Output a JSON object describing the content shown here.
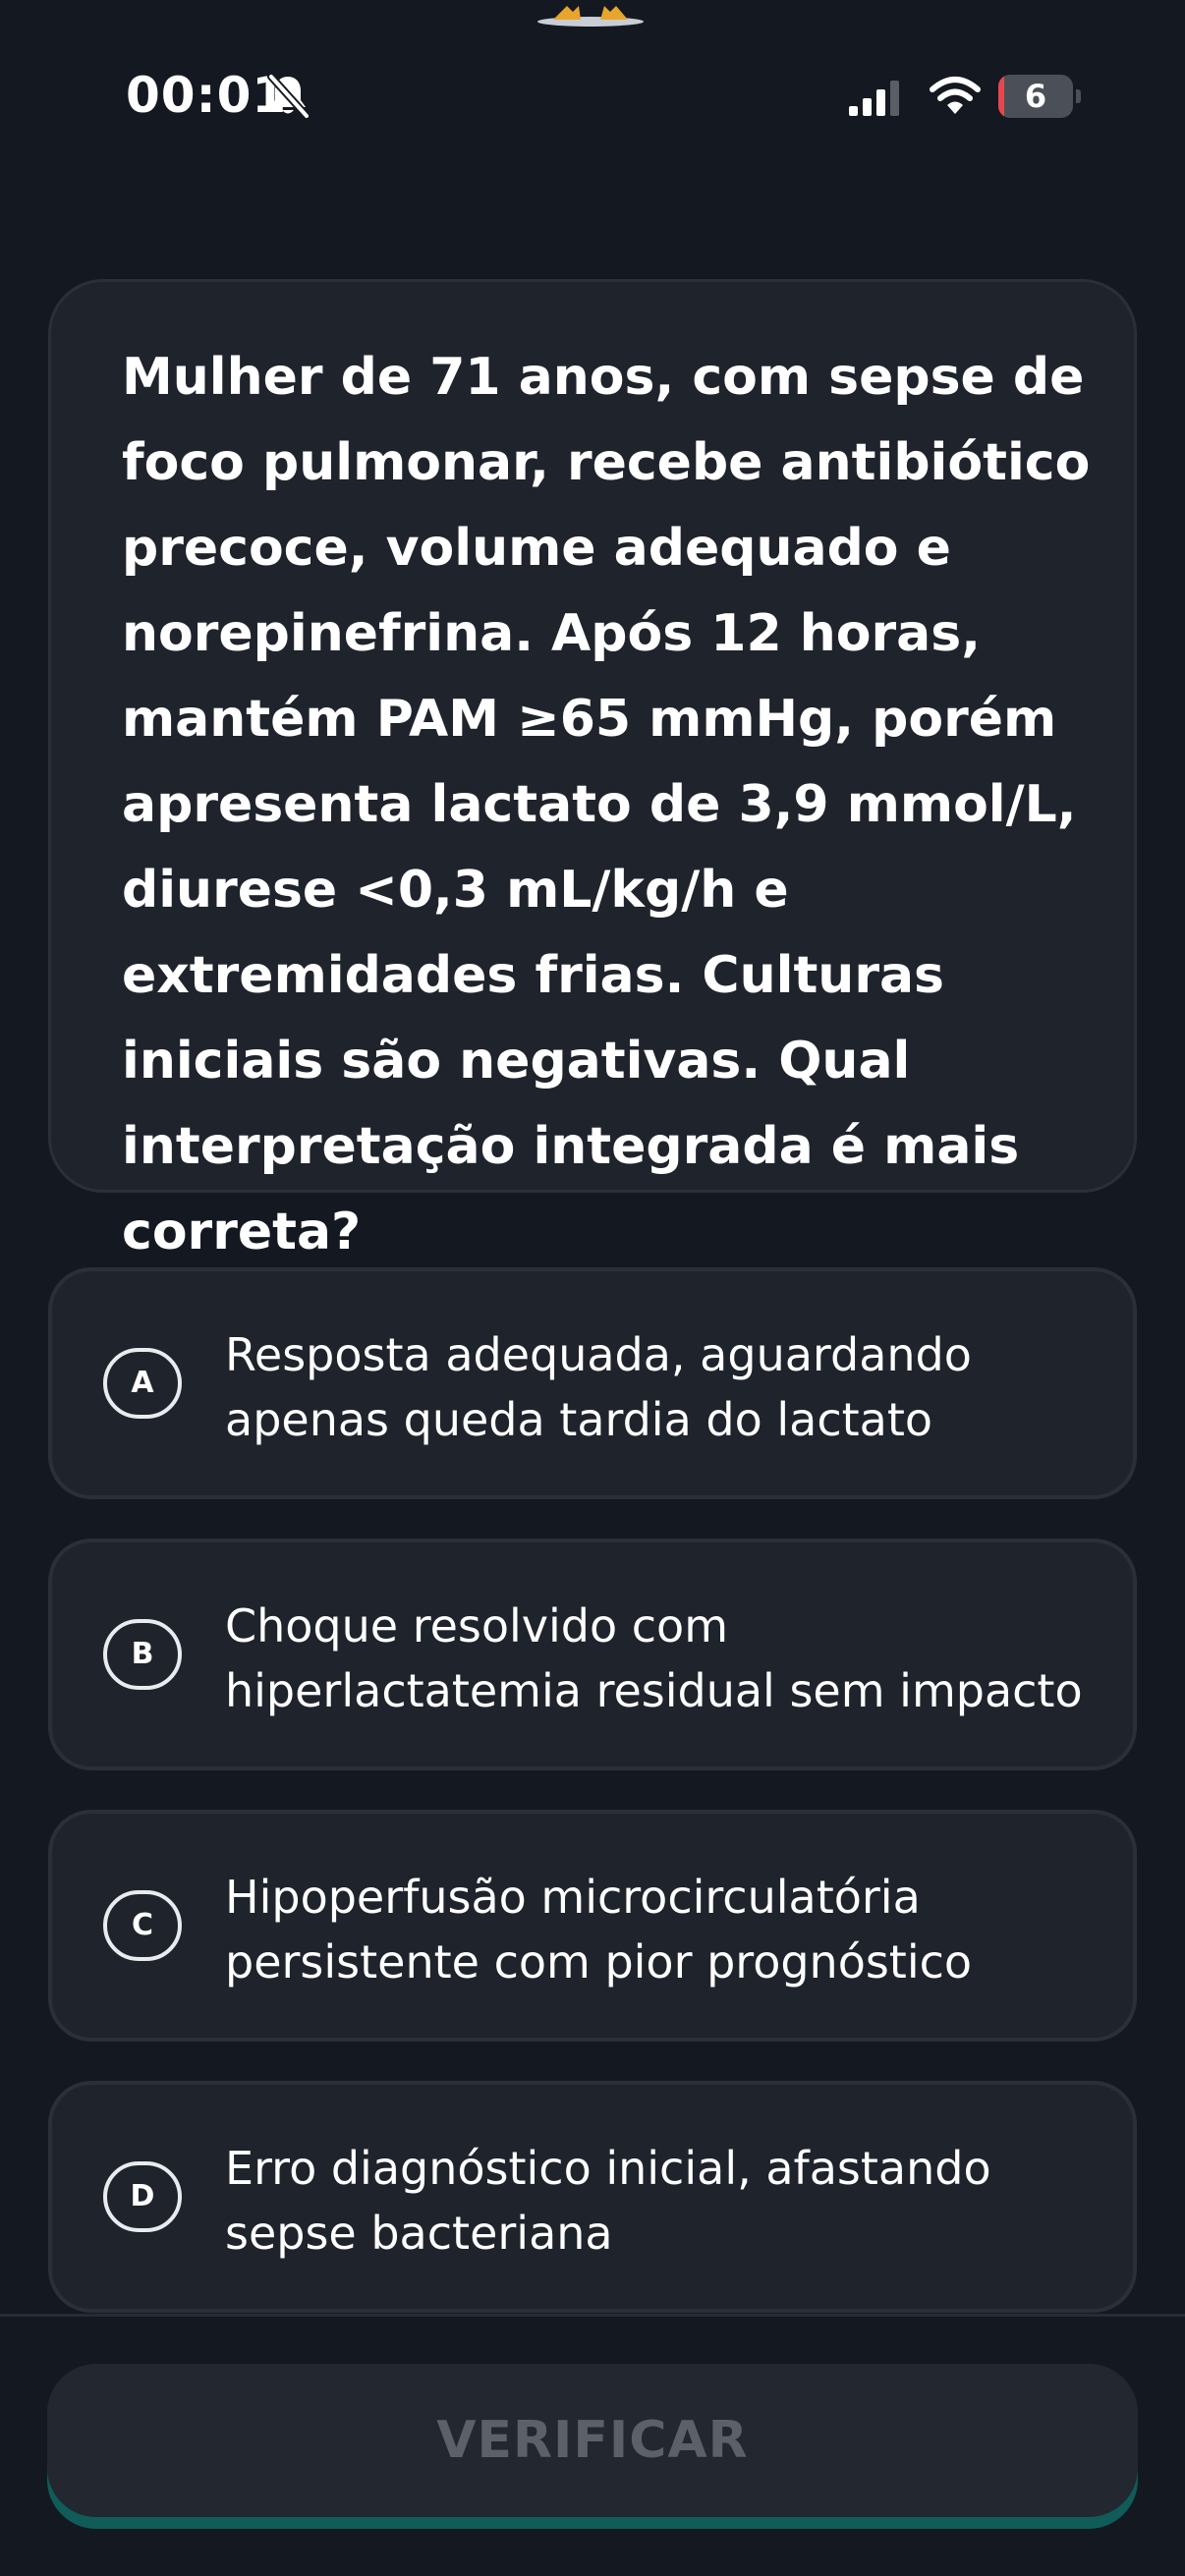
{
  "status_bar": {
    "time": "00:01",
    "battery_level": "6",
    "icons": [
      "bell-muted-icon",
      "signal-icon",
      "wifi-icon",
      "battery-icon"
    ]
  },
  "question": {
    "text": "Mulher de 71 anos, com sepse de foco pulmonar, recebe antibiótico precoce, volume adequado e norepinefrina. Após 12 horas, mantém PAM ≥65 mmHg, porém apresenta lactato de 3,9 mmol/L, diurese <0,3 mL/kg/h e extremidades frias. Culturas iniciais são negativas. Qual interpretação integrada é mais correta?"
  },
  "options": [
    {
      "letter": "A",
      "text": "Resposta adequada, aguardando apenas queda tardia do lactato"
    },
    {
      "letter": "B",
      "text": "Choque resolvido com hiperlactatemia residual sem impacto"
    },
    {
      "letter": "C",
      "text": "Hipoperfusão microcirculatória persistente com pior prognóstico"
    },
    {
      "letter": "D",
      "text": "Erro diagnóstico inicial, afastando sepse bacteriana"
    }
  ],
  "verify_button": {
    "label": "VERIFICAR"
  },
  "colors": {
    "background": "#141921",
    "card": "#1f232c",
    "card_border": "#2a2f39",
    "button_disabled_text": "#5b6069",
    "button_accent": "#0f5c58",
    "battery_low": "#e5484d"
  }
}
